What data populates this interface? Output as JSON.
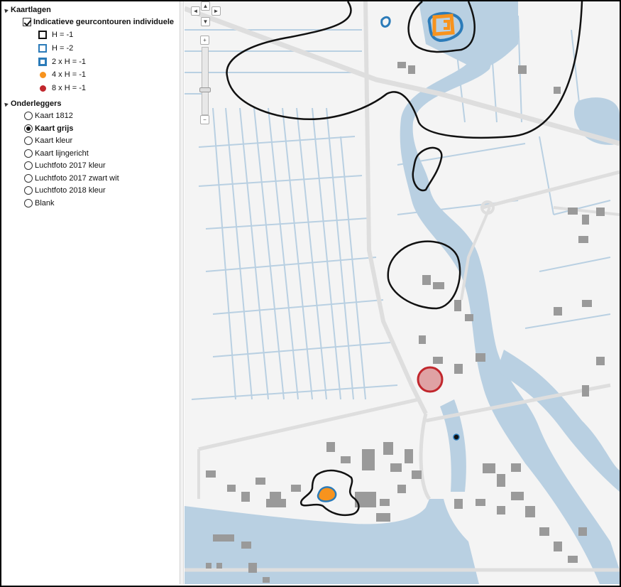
{
  "panel": {
    "kaartlagen_title": "Kaartlagen",
    "layer_label": "Indicatieve geurcontouren individuele",
    "legend": [
      {
        "label": "H = -1",
        "symbol": "square-black"
      },
      {
        "label": "H = -2",
        "symbol": "square-blue"
      },
      {
        "label": "2 x H = -1",
        "symbol": "square-blue-dot"
      },
      {
        "label": "4 x H = -1",
        "symbol": "dot-orange"
      },
      {
        "label": "8 x H = -1",
        "symbol": "dot-red"
      }
    ],
    "onderleggers_title": "Onderleggers",
    "basemaps": [
      {
        "label": "Kaart 1812",
        "selected": false
      },
      {
        "label": "Kaart grijs",
        "selected": true
      },
      {
        "label": "Kaart kleur",
        "selected": false
      },
      {
        "label": "Kaart lijngericht",
        "selected": false
      },
      {
        "label": "Luchtfoto 2017 kleur",
        "selected": false
      },
      {
        "label": "Luchtfoto 2017 zwart wit",
        "selected": false
      },
      {
        "label": "Luchtfoto 2018 kleur",
        "selected": false
      },
      {
        "label": "Blank",
        "selected": false
      }
    ]
  },
  "nav": {
    "pan_left": "◄",
    "pan_right": "►",
    "pan_up": "▲",
    "pan_down": "▼",
    "zoom_in": "+",
    "zoom_out": "−"
  },
  "colors": {
    "water": "#b9d0e2",
    "land": "#f4f4f4",
    "building": "#9a9a9a",
    "contour_black": "#111111",
    "contour_blue": "#2b7bb9",
    "contour_orange": "#f7931e",
    "contour_red": "#c1272d"
  }
}
